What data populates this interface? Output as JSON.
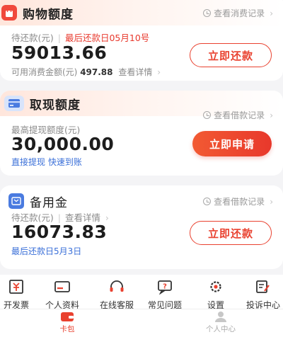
{
  "colors": {
    "accent": "#e9412f",
    "link_blue": "#3a6fd8",
    "muted": "#8a8a8a"
  },
  "shopping_card": {
    "title": "购物额度",
    "record_link": "查看消费记录",
    "due_label": "待还款(元)",
    "last_due": "最后还款日05月10号",
    "amount": "59013.66",
    "available_label": "可用消费金额(元)",
    "available_value": "497.88",
    "details_link": "查看详情",
    "button": "立即还款"
  },
  "cash_card": {
    "title": "取现额度",
    "record_link": "查看借款记录",
    "limit_label": "最高提现额度(元)",
    "amount": "30,000.00",
    "features": "直接提现 快速到账",
    "button": "立即申请"
  },
  "reserve_card": {
    "title": "备用金",
    "record_link": "查看借款记录",
    "due_label": "待还款(元)",
    "details_link": "查看详情",
    "amount": "16073.83",
    "last_due": "最后还款日5月3日",
    "button": "立即还款"
  },
  "tools": [
    {
      "label": "开发票",
      "icon": "invoice-icon"
    },
    {
      "label": "个人资料",
      "icon": "id-card-icon"
    },
    {
      "label": "在线客服",
      "icon": "headset-icon"
    },
    {
      "label": "常见问题",
      "icon": "faq-icon"
    },
    {
      "label": "设置",
      "icon": "gear-icon"
    },
    {
      "label": "投诉中心",
      "icon": "complaint-icon"
    }
  ],
  "tabbar": {
    "wallet": {
      "label": "卡包",
      "icon": "wallet-icon",
      "active": true
    },
    "profile": {
      "label": "个人中心",
      "icon": "user-icon",
      "active": false
    }
  }
}
